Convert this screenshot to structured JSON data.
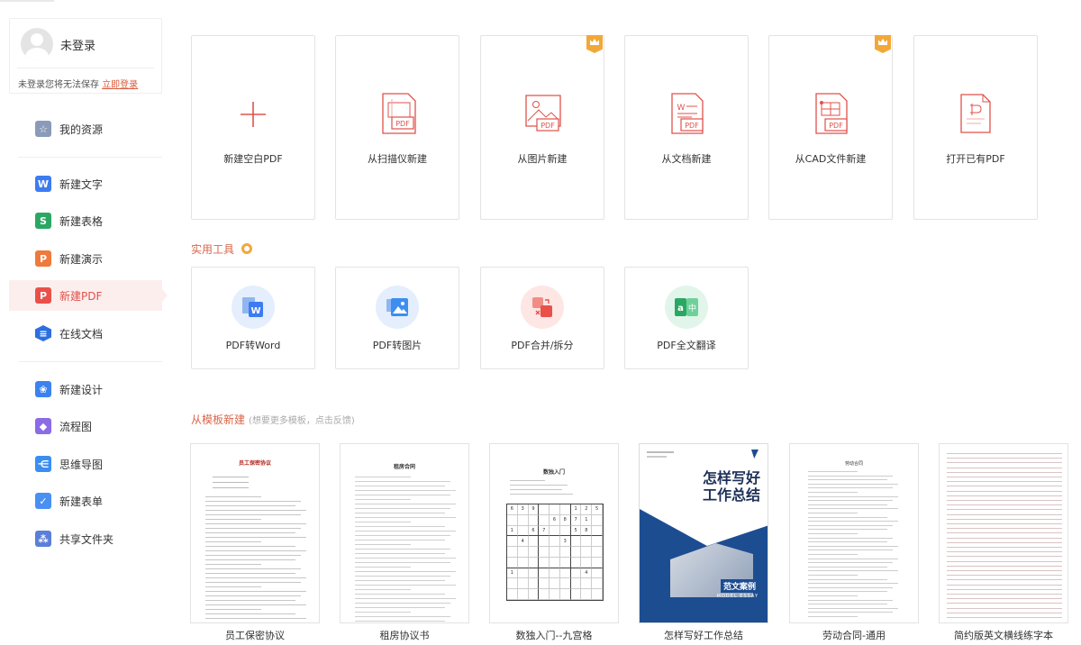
{
  "user": {
    "name": "未登录",
    "tip": "未登录您将无法保存",
    "login_link": "立即登录"
  },
  "sidebar": {
    "items": [
      {
        "label": "我的资源",
        "icon": "star-icon",
        "color": "#8a9ab8"
      },
      {
        "label": "新建文字",
        "icon": "writer-icon",
        "color": "#3d7cf0"
      },
      {
        "label": "新建表格",
        "icon": "sheet-icon",
        "color": "#2aa863"
      },
      {
        "label": "新建演示",
        "icon": "presentation-icon",
        "color": "#ee7a3c"
      },
      {
        "label": "新建PDF",
        "icon": "pdf-icon",
        "color": "#e9504a"
      },
      {
        "label": "在线文档",
        "icon": "cloud-doc-icon",
        "color": "#2c6fe0"
      },
      {
        "label": "新建设计",
        "icon": "design-icon",
        "color": "#3b82f0"
      },
      {
        "label": "流程图",
        "icon": "flowchart-icon",
        "color": "#8b6be6"
      },
      {
        "label": "思维导图",
        "icon": "mindmap-icon",
        "color": "#3a8ef0"
      },
      {
        "label": "新建表单",
        "icon": "form-icon",
        "color": "#4a8ff2"
      },
      {
        "label": "共享文件夹",
        "icon": "shared-folder-icon",
        "color": "#5b7fd8"
      }
    ]
  },
  "create": {
    "cards": [
      {
        "label": "新建空白PDF",
        "icon": "plus-icon",
        "vip": false
      },
      {
        "label": "从扫描仪新建",
        "icon": "scanner-pdf-icon",
        "vip": false
      },
      {
        "label": "从图片新建",
        "icon": "image-pdf-icon",
        "vip": true
      },
      {
        "label": "从文档新建",
        "icon": "word-pdf-icon",
        "vip": false
      },
      {
        "label": "从CAD文件新建",
        "icon": "cad-pdf-icon",
        "vip": true
      },
      {
        "label": "打开已有PDF",
        "icon": "open-pdf-icon",
        "vip": false
      }
    ]
  },
  "tools": {
    "title": "实用工具",
    "items": [
      {
        "label": "PDF转Word",
        "icon": "pdf-to-word-icon"
      },
      {
        "label": "PDF转图片",
        "icon": "pdf-to-image-icon"
      },
      {
        "label": "PDF合并/拆分",
        "icon": "pdf-merge-split-icon"
      },
      {
        "label": "PDF全文翻译",
        "icon": "pdf-translate-icon"
      }
    ]
  },
  "templates": {
    "title": "从模板新建",
    "subtitle": "(想要更多模板，点击反馈)",
    "items": [
      {
        "label": "员工保密协议",
        "doc_title": "员工保密协议"
      },
      {
        "label": "租房协议书",
        "doc_title": "租房合同"
      },
      {
        "label": "数独入门--九宫格",
        "doc_title": "数独入门"
      },
      {
        "label": "怎样写好工作总结",
        "doc_title": "怎样写好工作总结",
        "badge": "范文案例",
        "badge_sub": "MODEL ESSAY"
      },
      {
        "label": "劳动合同-通用",
        "doc_title": "劳动合同"
      },
      {
        "label": "简约版英文横线练字本",
        "doc_title": ""
      }
    ],
    "sudoku": [
      "6",
      "3",
      "9",
      "",
      "",
      "",
      "1",
      "2",
      "5",
      "",
      "",
      "",
      "",
      "6",
      "8",
      "7",
      "1",
      "",
      "1",
      "",
      "6",
      "7",
      "",
      "",
      "5",
      "8",
      "",
      "",
      "4",
      "",
      "",
      "",
      "3",
      "",
      "",
      "",
      "",
      "",
      "",
      "",
      "",
      "",
      "",
      "",
      "",
      "",
      "",
      "",
      "",
      "",
      "",
      "",
      "",
      "",
      "1",
      "",
      "",
      "",
      "",
      "",
      "",
      "4",
      "",
      "",
      "",
      "",
      "",
      "",
      "",
      "",
      "",
      "",
      "",
      "",
      "",
      "",
      "",
      "",
      "",
      "",
      ""
    ]
  },
  "colors": {
    "accent": "#e0514b",
    "section": "#d9674b",
    "vip": "#f2a838"
  }
}
